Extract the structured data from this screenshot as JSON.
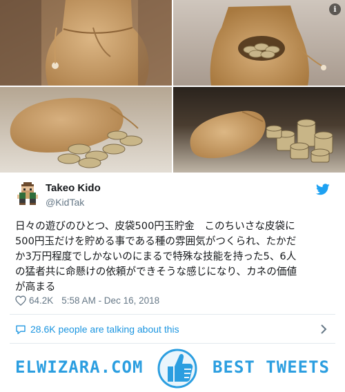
{
  "tweet": {
    "display_name": "Takeo Kido",
    "handle": "@KidTak",
    "text": "日々の遊びのひとつ、皮袋500円玉貯金　このちいさな皮袋に\n500円玉だけを貯める事である種の雰囲気がつくられ、たかだ\nか3万円程度でしかないのにまるで特殊な技能を持った5、6人\nの猛者共に命懸けの依頼ができそうな感じになり、カネの価値\nが高まる",
    "likes": "64.2K",
    "timestamp": "5:58 AM - Dec 16, 2018",
    "talking": "28.6K people are talking about this"
  },
  "media": {
    "info_glyph": "i",
    "photos": [
      "leather-pouch-closed",
      "leather-pouch-open-with-coins",
      "pouch-spilling-coins",
      "pouch-with-coin-stacks"
    ]
  },
  "banner": {
    "site": "ELWIZARA.COM",
    "tagline": "BEST TWEETS"
  },
  "icons": {
    "info": "info-icon",
    "twitter": "twitter-bird-icon",
    "like": "heart-icon",
    "talking": "speech-bubble-icon",
    "more": "chevron-right-icon",
    "banner_thumb": "thumbs-up-icon"
  },
  "colors": {
    "twitter_blue": "#1b95e0",
    "banner_blue": "#2b9ee0",
    "secondary_text": "#657786",
    "leather": "#c9a06a"
  }
}
